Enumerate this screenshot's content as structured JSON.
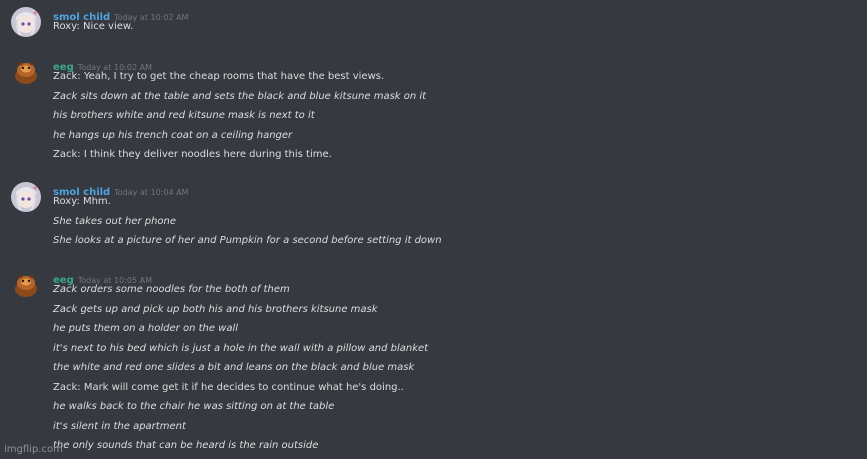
{
  "messages": [
    {
      "username": "smol child",
      "timestamp": "Today at 10:02 AM",
      "color": "#4fa3e0",
      "avatar": "anime-girl-avatar-icon",
      "lines": [
        {
          "text": "Roxy: Nice view.",
          "italic": false
        }
      ]
    },
    {
      "username": "eeg",
      "timestamp": "Today at 10:02 AM",
      "color": "#3aa58c",
      "avatar": "orange-creature-avatar-icon",
      "lines": [
        {
          "text": "Zack: Yeah, I try to get the cheap rooms that have the best views.",
          "italic": false
        },
        {
          "text": "Zack sits down at the table and sets the black and blue kitsune mask on it",
          "italic": true
        },
        {
          "text": "his brothers white and red kitsune mask is next to it",
          "italic": true
        },
        {
          "text": "he hangs up his trench coat on a ceiling hanger",
          "italic": true
        },
        {
          "text": "Zack: I think they deliver noodles here during this time.",
          "italic": false
        }
      ]
    },
    {
      "username": "smol child",
      "timestamp": "Today at 10:04 AM",
      "color": "#4fa3e0",
      "avatar": "anime-girl-avatar-icon",
      "lines": [
        {
          "text": "Roxy: Mhm.",
          "italic": false
        },
        {
          "text": "She takes out her phone",
          "italic": true
        },
        {
          "text": "She looks at a picture of her and Pumpkin for a second before setting it down",
          "italic": true
        }
      ]
    },
    {
      "username": "eeg",
      "timestamp": "Today at 10:05 AM",
      "color": "#3aa58c",
      "avatar": "orange-creature-avatar-icon",
      "lines": [
        {
          "text": "Zack orders some noodles for the both of them",
          "italic": true
        },
        {
          "text": "Zack gets up and pick up both his and his brothers kitsune mask",
          "italic": true
        },
        {
          "text": "he puts them on a holder on the wall",
          "italic": true
        },
        {
          "text": "it's next to his bed which is just a hole in the wall with a pillow and blanket",
          "italic": true
        },
        {
          "text": "the white and red one slides a bit and leans on the black and blue mask",
          "italic": true
        },
        {
          "text": "Zack: Mark will come get it if he decides to continue what he's doing..",
          "italic": false
        },
        {
          "text": "he walks back to the chair he was sitting on at the table",
          "italic": true
        },
        {
          "text": "it's silent in the apartment",
          "italic": true
        },
        {
          "text": "the only sounds that can be heard is the rain outside",
          "italic": true
        }
      ]
    }
  ],
  "watermark": "imgflip.com"
}
